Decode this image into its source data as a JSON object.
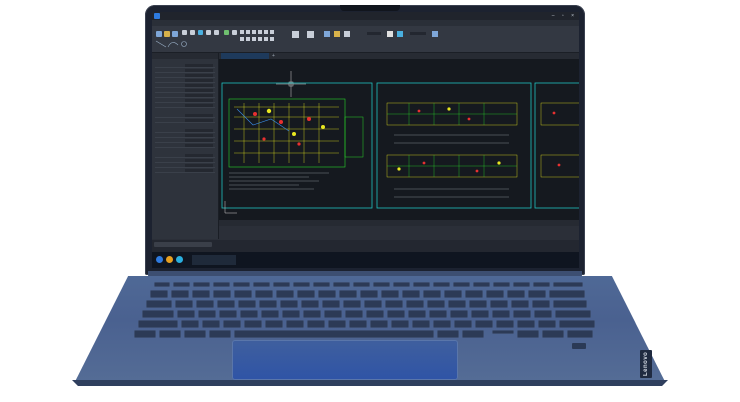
{
  "app": {
    "title_text": "",
    "menu": [
      "",
      "",
      "",
      "",
      "",
      "",
      "",
      "",
      "",
      "",
      "",
      ""
    ],
    "properties_title": "",
    "document_tab": "",
    "layout_tabs": [
      "",
      "",
      ""
    ],
    "command_tab": "",
    "taskbar_app": "",
    "clock_time": "",
    "clock_date": ""
  },
  "device": {
    "brand": "Lenovo"
  },
  "colors": {
    "screen_bg": "#15191f",
    "cad_frame": "#20c0c0",
    "cad_green": "#28d428",
    "cad_yellow": "#e8e820",
    "cad_red": "#e83030",
    "chassis": "#4f6996",
    "touchpad": "#2f54a6"
  }
}
